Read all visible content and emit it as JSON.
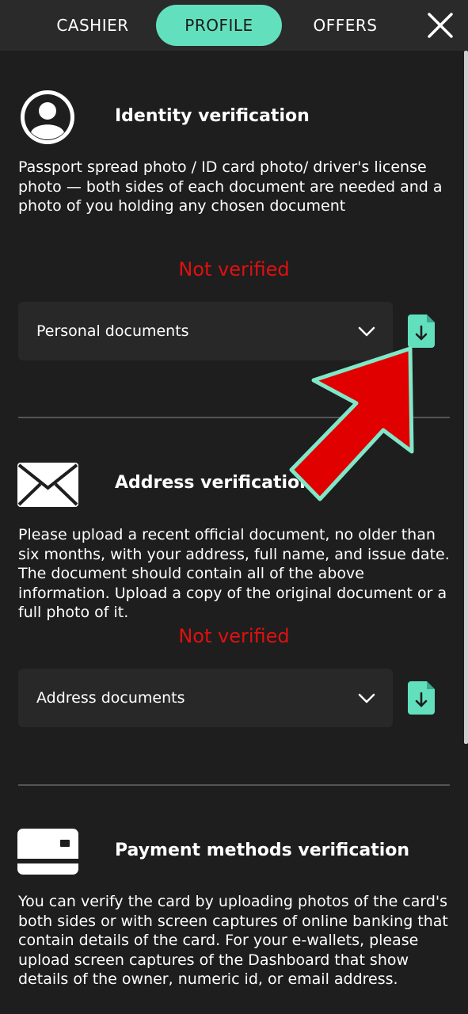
{
  "tabs": [
    {
      "label": "CASHIER",
      "active": false
    },
    {
      "label": "PROFILE",
      "active": true
    },
    {
      "label": "OFFERS",
      "active": false
    }
  ],
  "colors": {
    "accent": "#62e0bd",
    "status_error": "#e01010",
    "background": "#1e1e1e",
    "annotation_arrow": "#e00000"
  },
  "sections": [
    {
      "icon": "user-circle-icon",
      "title": "Identity verification",
      "description": "Passport spread photo / ID card photo/ driver's license photo — both sides of each document are needed and a photo of you holding any chosen document",
      "status": "Not verified",
      "dropdown": "Personal documents"
    },
    {
      "icon": "envelope-icon",
      "title": "Address verification",
      "description": "Please upload a recent official document, no older than six months, with your address, full name, and issue date. The document should contain all of the above information. Upload a copy of the original document or a full photo of it.",
      "status": "Not verified",
      "dropdown": "Address documents"
    },
    {
      "icon": "credit-card-icon",
      "title": "Payment methods verification",
      "description": "You can verify the card by uploading photos of the card's both sides or with screen captures of online banking that contain details of the card. For your e-wallets, please upload screen captures of the Dashboard that show details of the owner, numeric id, or email address."
    }
  ]
}
